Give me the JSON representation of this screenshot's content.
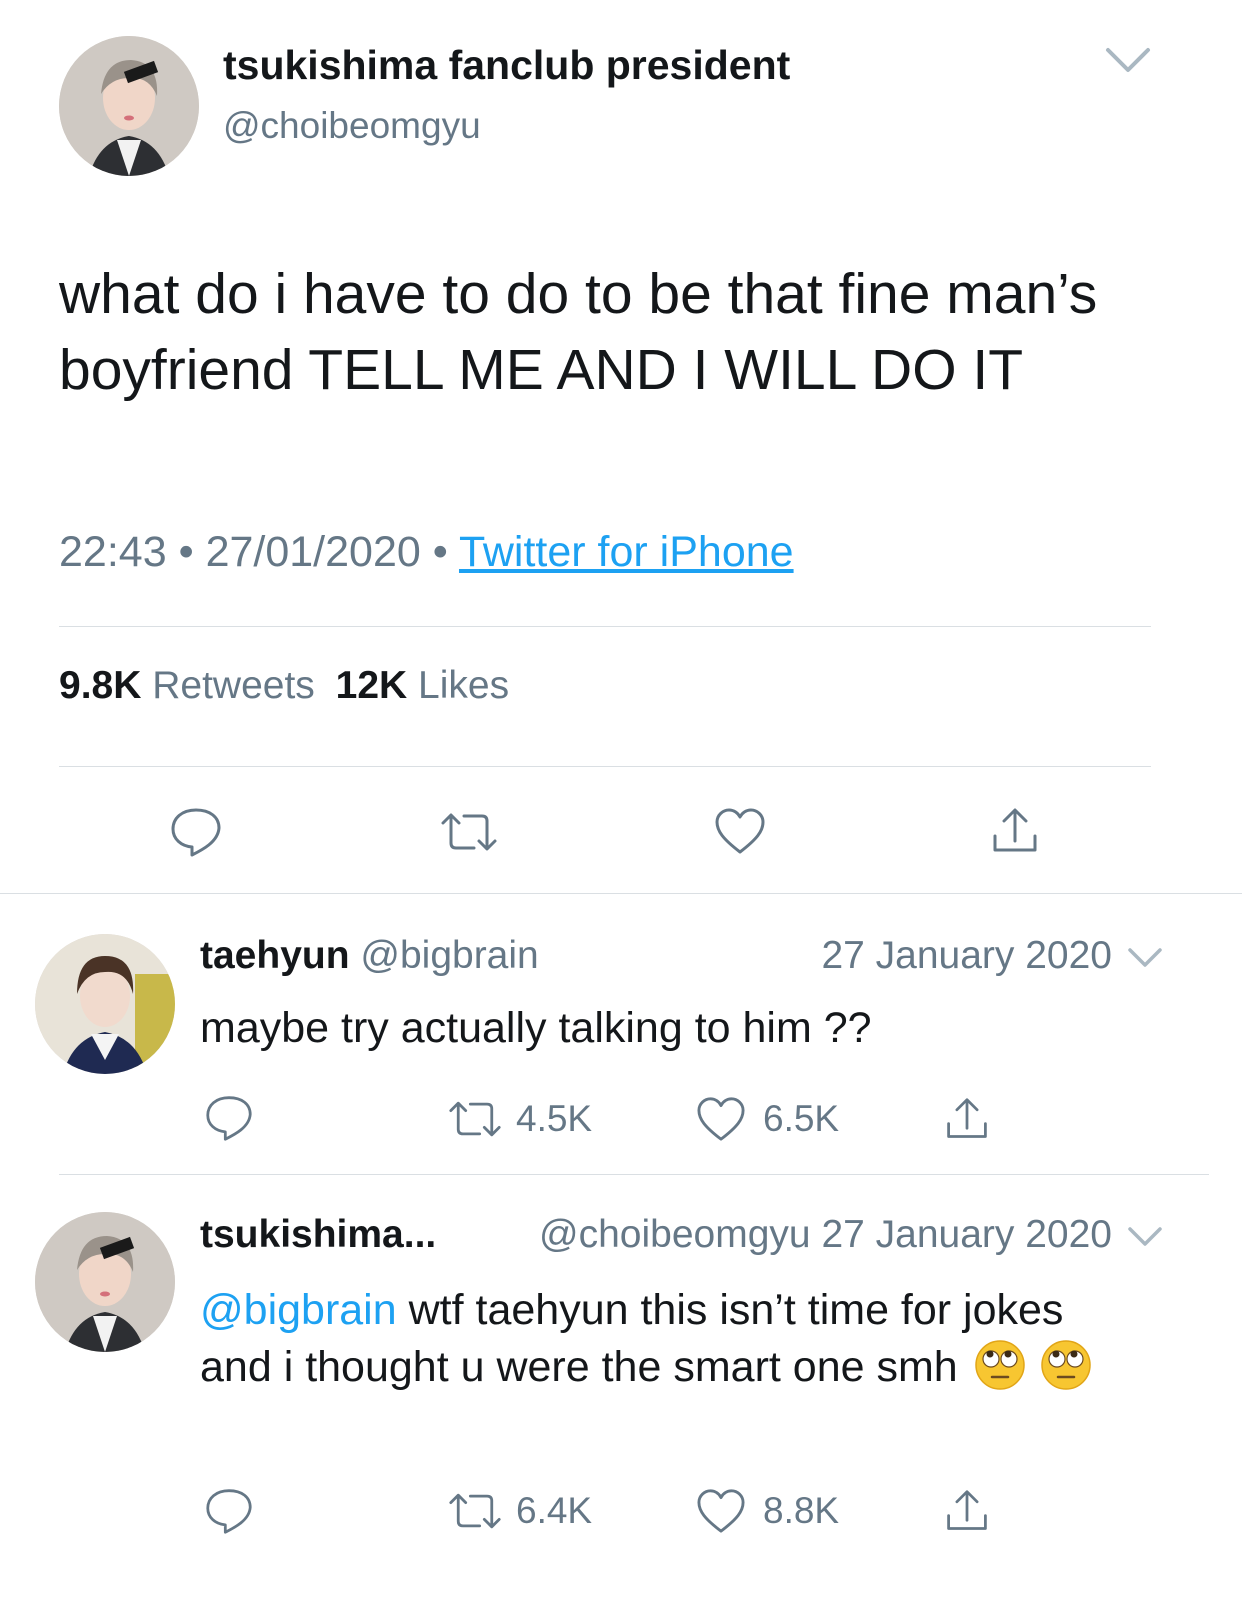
{
  "main_tweet": {
    "display_name": "tsukishima fanclub president",
    "handle": "@choibeomgyu",
    "text": "what do i have to do to be that fine man’s boyfriend TELL ME AND I WILL DO IT",
    "time": "22:43",
    "date": "27/01/2020",
    "separator": "•",
    "source": "Twitter for iPhone",
    "retweets_count": "9.8K",
    "retweets_label": "Retweets",
    "likes_count": "12K",
    "likes_label": "Likes"
  },
  "replies": [
    {
      "display_name": "taehyun",
      "handle": "@bigbrain",
      "date": "27 January 2020",
      "text": "maybe try actually talking to him ??",
      "retweets": "4.5K",
      "likes": "6.5K"
    },
    {
      "display_name": "tsukishima...",
      "handle": "@choibeomgyu",
      "date": "27 January 2020",
      "mention": "@bigbrain",
      "text": "wtf taehyun this isn’t time for jokes and i thought u were the smart one smh",
      "emojis": [
        "face-with-rolling-eyes",
        "face-with-rolling-eyes"
      ],
      "retweets": "6.4K",
      "likes": "8.8K"
    }
  ],
  "colors": {
    "link": "#1da1f2",
    "secondary_text": "#657786",
    "divider": "#dadfe3"
  }
}
